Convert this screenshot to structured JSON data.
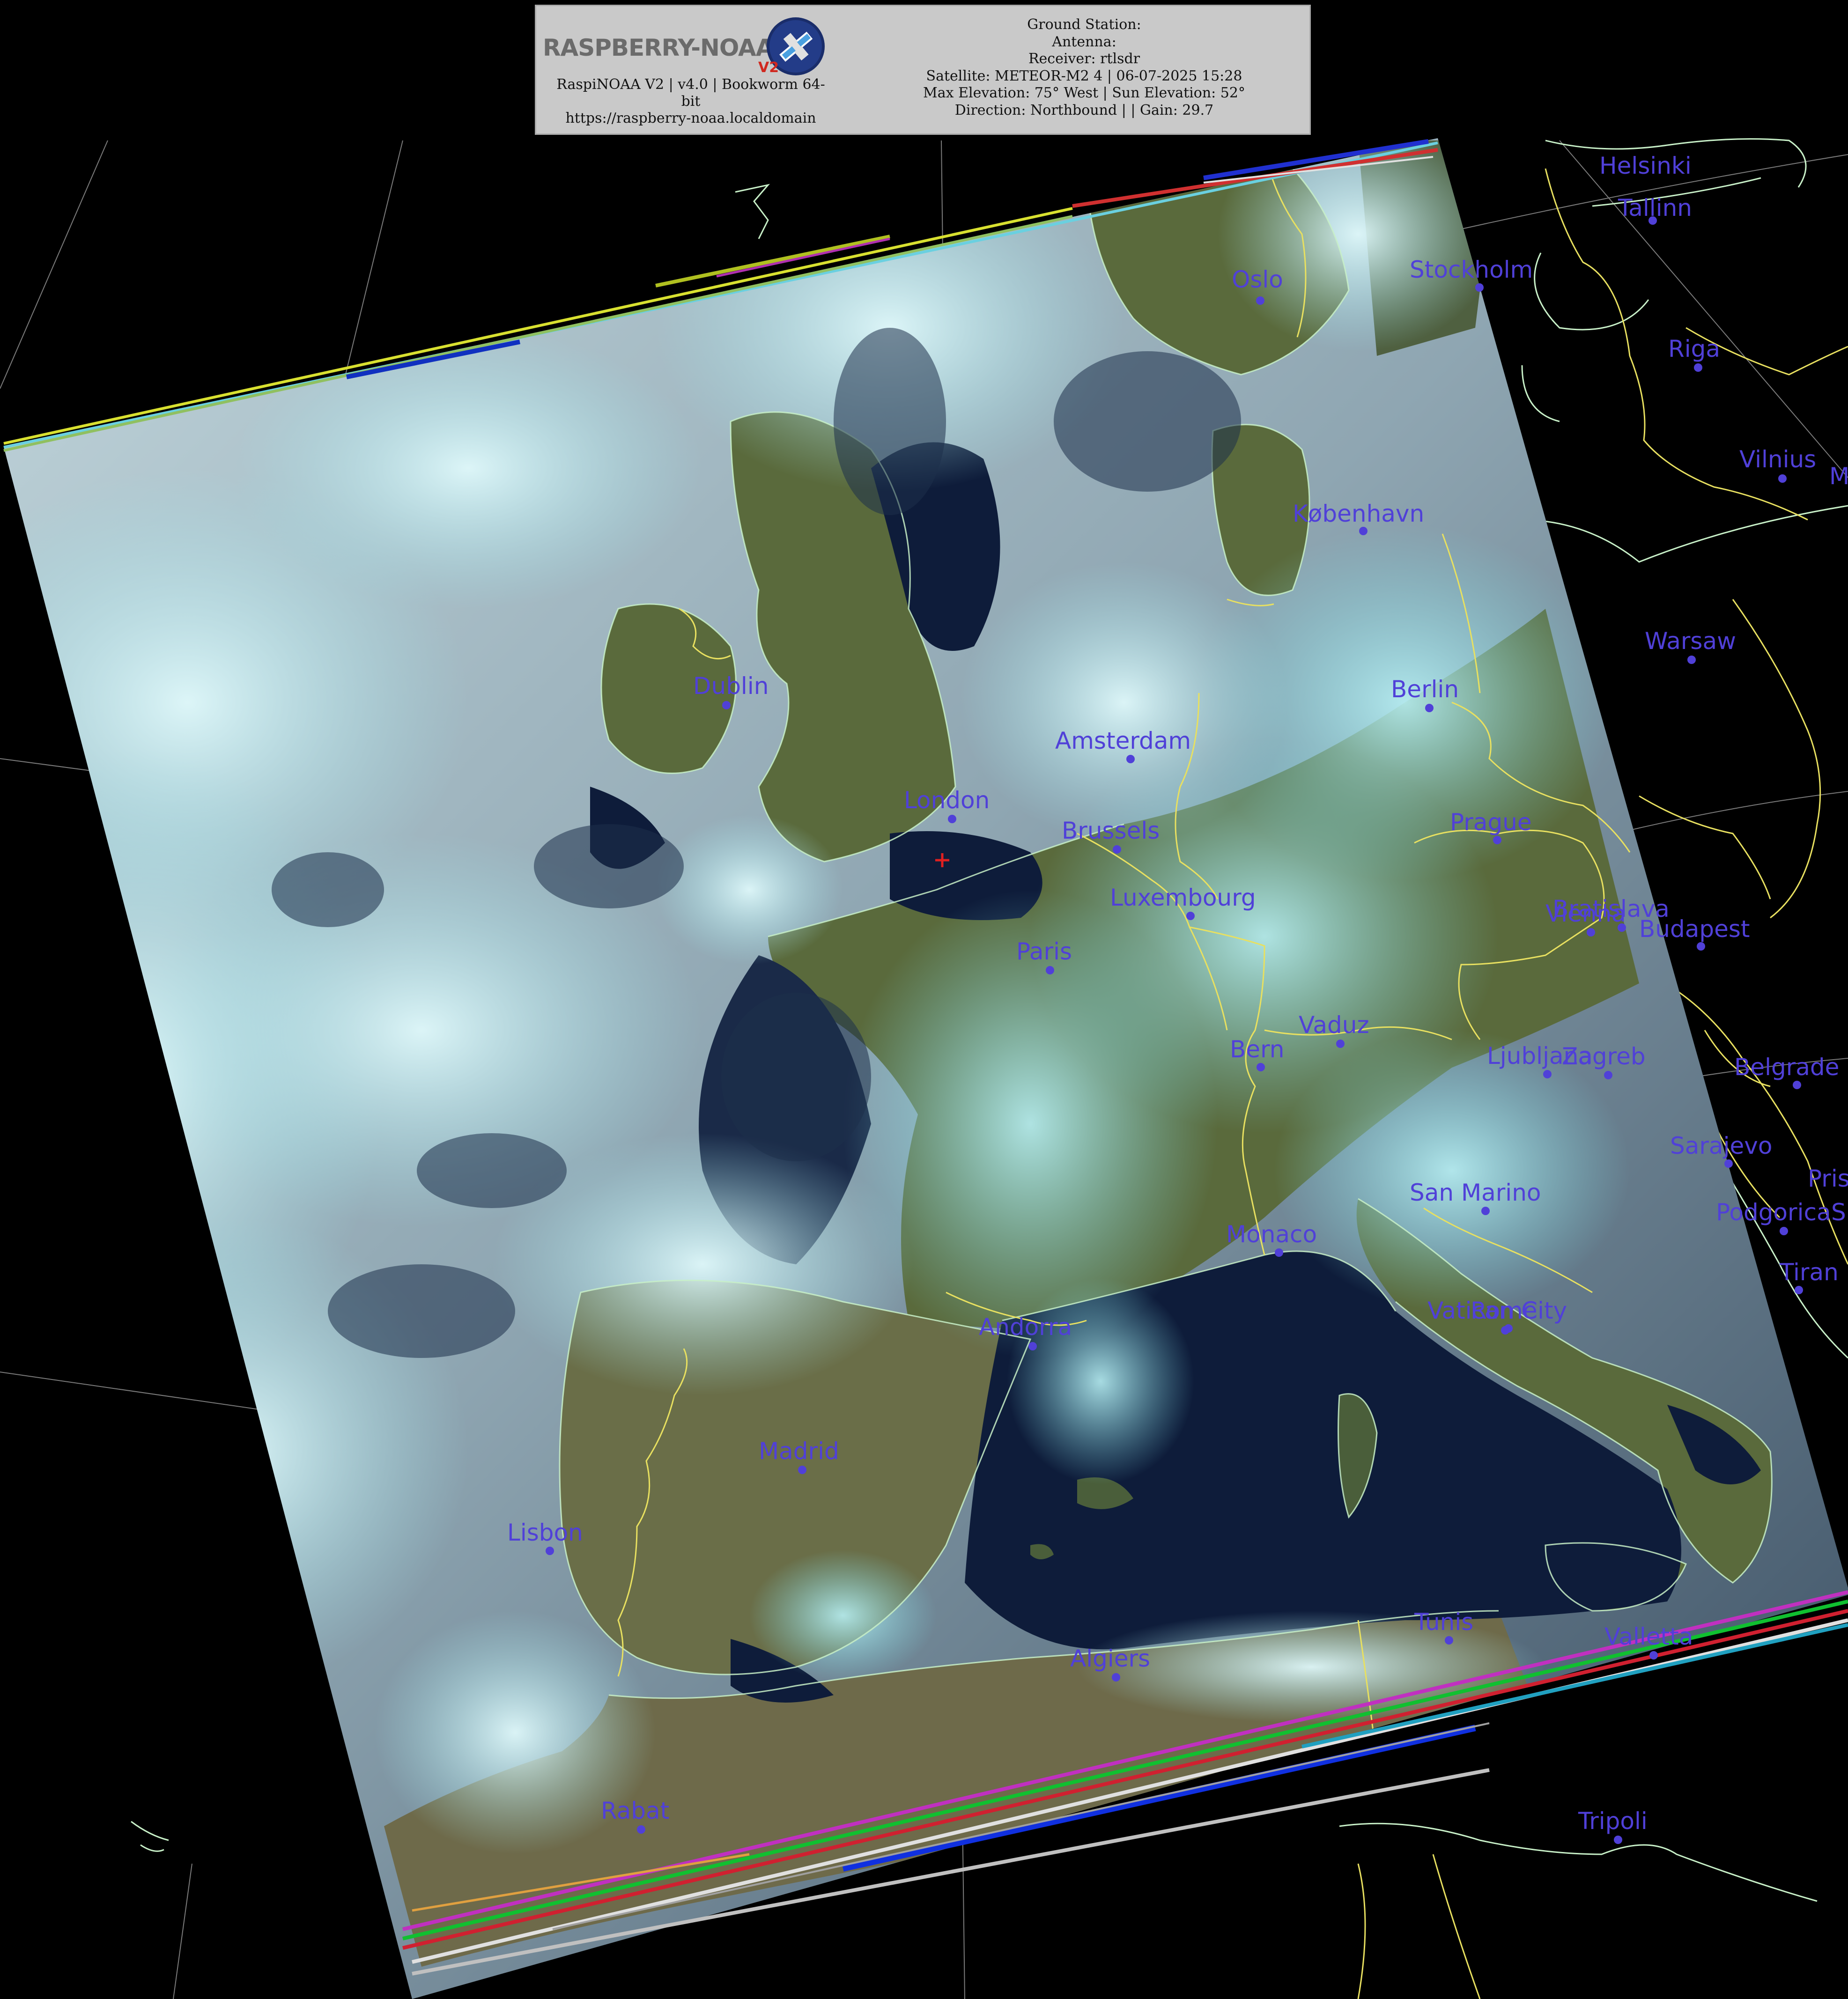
{
  "header": {
    "logo_text": "RASPBERRY-NOAA",
    "logo_badge": "V2",
    "software_line_1": "RaspiNOAA V2 | v4.0 | Bookworm 64-",
    "software_line_2": "bit",
    "url": "https://raspberry-noaa.localdomain",
    "ground_station": "Ground Station:",
    "antenna": "Antenna:",
    "receiver": "Receiver: rtlsdr",
    "satellite": "Satellite: METEOR-M2 4 | 06-07-2025 15:28",
    "elevation": "Max Elevation: 75° West | Sun Elevation: 52°",
    "direction": "Direction: Northbound | | Gain: 29.7"
  },
  "colors": {
    "city_label": "#5040d8",
    "coastline": "#c8f0c8",
    "border": "#e8e060",
    "graticule": "#9a9a9a",
    "cloud": "#a8e8ec",
    "land": "#5a6a3c",
    "sea": "#0e1c3a",
    "marker": "#e02020"
  },
  "station_marker_icon": "plus-marker-icon",
  "cities": [
    {
      "name": "Helsinki"
    },
    {
      "name": "Tallinn"
    },
    {
      "name": "Oslo"
    },
    {
      "name": "Stockholm"
    },
    {
      "name": "Riga"
    },
    {
      "name": "Vilnius"
    },
    {
      "name": "M"
    },
    {
      "name": "København"
    },
    {
      "name": "Warsaw"
    },
    {
      "name": "Dublin"
    },
    {
      "name": "Berlin"
    },
    {
      "name": "Amsterdam"
    },
    {
      "name": "London"
    },
    {
      "name": "Brussels"
    },
    {
      "name": "Prague"
    },
    {
      "name": "Luxembourg"
    },
    {
      "name": "Vienna"
    },
    {
      "name": "Bratislava"
    },
    {
      "name": "Budapest"
    },
    {
      "name": "Paris"
    },
    {
      "name": "Vaduz"
    },
    {
      "name": "Bern"
    },
    {
      "name": "Ljubljana"
    },
    {
      "name": "Zagreb"
    },
    {
      "name": "Belgrade"
    },
    {
      "name": "Sarajevo"
    },
    {
      "name": "Pris"
    },
    {
      "name": "San Marino"
    },
    {
      "name": "Podgorica"
    },
    {
      "name": "S"
    },
    {
      "name": "Monaco"
    },
    {
      "name": "Tiran"
    },
    {
      "name": "Andorra"
    },
    {
      "name": "Vatican City"
    },
    {
      "name": "Rome"
    },
    {
      "name": "Madrid"
    },
    {
      "name": "Lisbon"
    },
    {
      "name": "Tunis"
    },
    {
      "name": "Valletta"
    },
    {
      "name": "Algiers"
    },
    {
      "name": "Rabat"
    },
    {
      "name": "Tripoli"
    }
  ]
}
